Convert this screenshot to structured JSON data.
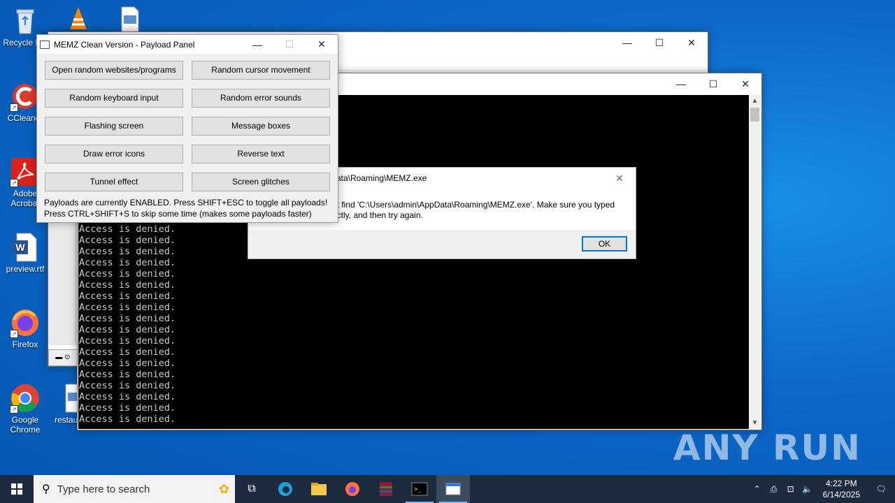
{
  "desktop": {
    "icons": [
      {
        "label": "Recycle Bin",
        "icon": "recycle-bin-icon"
      },
      {
        "label": "CCleaner",
        "icon": "ccleaner-icon"
      },
      {
        "label": "Adobe Acrobat",
        "icon": "acrobat-icon"
      },
      {
        "label": "preview.rtf",
        "icon": "word-doc-icon"
      },
      {
        "label": "Firefox",
        "icon": "firefox-icon"
      },
      {
        "label": "Google Chrome",
        "icon": "chrome-icon"
      },
      {
        "label": "restau",
        "icon": "image-file-icon"
      }
    ],
    "watermark": "ANY RUN"
  },
  "memz": {
    "title": "MEMZ Clean Version - Payload Panel",
    "buttons": [
      "Open random websites/programs",
      "Random cursor movement",
      "Random keyboard input",
      "Random error sounds",
      "Flashing screen",
      "Message boxes",
      "Draw error icons",
      "Reverse text",
      "Tunnel effect",
      "Screen glitches"
    ],
    "status_line1": "Payloads are currently ENABLED. Press SHIFT+ESC to toggle all payloads!",
    "status_line2": "Press CTRL+SHIFT+S to skip some time (makes some payloads faster)"
  },
  "console": {
    "line": "Access is denied.",
    "line_count": 18
  },
  "error_dialog": {
    "title": "ata\\Roaming\\MEMZ.exe",
    "message_line1": "ot find 'C:\\Users\\admin\\AppData\\Roaming\\MEMZ.exe'. Make sure you typed",
    "message_line2": "ectly, and then try again.",
    "ok_label": "OK"
  },
  "taskbar": {
    "search_placeholder": "Type here to search",
    "time": "4:22 PM",
    "date": "6/14/2025"
  }
}
